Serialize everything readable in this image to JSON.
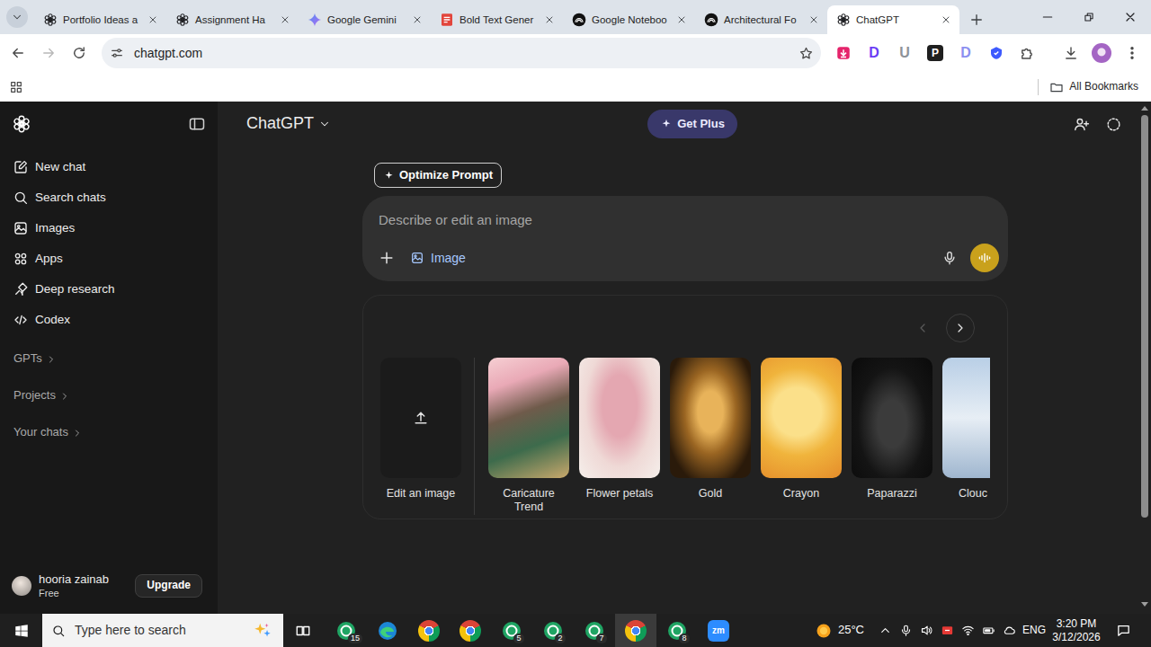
{
  "browser": {
    "tabs": [
      {
        "label": "Portfolio Ideas a",
        "kind": "chatgpt",
        "selected": false
      },
      {
        "label": "Assignment Ha",
        "kind": "chatgpt",
        "selected": false
      },
      {
        "label": "Google Gemini",
        "kind": "gemini",
        "selected": false
      },
      {
        "label": "Bold Text Gener",
        "kind": "doc",
        "selected": false
      },
      {
        "label": "Google Noteboo",
        "kind": "notebook",
        "selected": false
      },
      {
        "label": "Architectural Fo",
        "kind": "notebook",
        "selected": false
      },
      {
        "label": "ChatGPT",
        "kind": "chatgpt",
        "selected": true
      }
    ],
    "nav": {
      "back_disabled": false,
      "forward_disabled": true
    },
    "url": "chatgpt.com",
    "extensions": [
      {
        "kind": "download"
      },
      {
        "kind": "letter",
        "letter": "D",
        "color": "#6a3cf5"
      },
      {
        "kind": "letter",
        "letter": "U",
        "color": "#8e9299"
      },
      {
        "kind": "tile",
        "letter": "P",
        "color": "#1f1f1f"
      },
      {
        "kind": "letter",
        "letter": "D",
        "color": "#8b8ff0"
      },
      {
        "kind": "shield"
      },
      {
        "kind": "puzzle"
      }
    ],
    "bookmarks": {
      "label": "All Bookmarks"
    }
  },
  "sidebar": {
    "items": [
      {
        "label": "New chat",
        "kind": "compose"
      },
      {
        "label": "Search chats",
        "kind": "search"
      },
      {
        "label": "Images",
        "kind": "images"
      },
      {
        "label": "Apps",
        "kind": "apps"
      },
      {
        "label": "Deep research",
        "kind": "research"
      },
      {
        "label": "Codex",
        "kind": "code"
      }
    ],
    "sections": [
      {
        "label": "GPTs"
      },
      {
        "label": "Projects"
      },
      {
        "label": "Your chats"
      }
    ],
    "user": {
      "name": "hooria zainab",
      "plan": "Free"
    },
    "upgrade": "Upgrade"
  },
  "header": {
    "model": "ChatGPT",
    "get_plus": "Get Plus"
  },
  "composer": {
    "optimize": "Optimize Prompt",
    "placeholder": "Describe or edit an image",
    "tool": {
      "label": "Image",
      "selected": true
    }
  },
  "gallery": {
    "prev_disabled": true,
    "next_disabled": false,
    "items": [
      {
        "label": "Edit an image",
        "kind": "upload"
      },
      {
        "label": "Caricature Trend",
        "kind": "photo"
      },
      {
        "label": "Flower petals",
        "kind": "photo"
      },
      {
        "label": "Gold",
        "kind": "photo"
      },
      {
        "label": "Crayon",
        "kind": "photo"
      },
      {
        "label": "Paparazzi",
        "kind": "photo"
      },
      {
        "label": "Clouc",
        "kind": "photo"
      }
    ]
  },
  "taskbar": {
    "search": {
      "placeholder": "Type here to search"
    },
    "apps": [
      {
        "kind": "chat",
        "badge": "15",
        "selected": false
      },
      {
        "kind": "edge",
        "selected": false
      },
      {
        "kind": "chrome",
        "selected": false
      },
      {
        "kind": "chrome",
        "selected": false
      },
      {
        "kind": "chat",
        "badge": "5",
        "selected": false
      },
      {
        "kind": "chat",
        "badge": "2",
        "selected": false
      },
      {
        "kind": "chat",
        "badge": "7",
        "selected": false
      },
      {
        "kind": "chrome",
        "selected": true
      },
      {
        "kind": "chat",
        "badge": "8",
        "selected": false
      },
      {
        "kind": "zoom",
        "letter": "zm",
        "selected": false
      }
    ],
    "weather": "25°C",
    "language": "ENG",
    "time": "3:20 PM",
    "date": "3/12/2026"
  }
}
